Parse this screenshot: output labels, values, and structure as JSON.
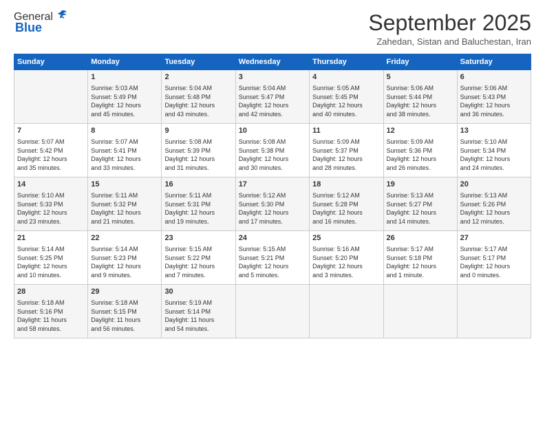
{
  "logo": {
    "general": "General",
    "blue": "Blue"
  },
  "title": "September 2025",
  "subtitle": "Zahedan, Sistan and Baluchestan, Iran",
  "days_header": [
    "Sunday",
    "Monday",
    "Tuesday",
    "Wednesday",
    "Thursday",
    "Friday",
    "Saturday"
  ],
  "weeks": [
    [
      {
        "day": "",
        "info": ""
      },
      {
        "day": "1",
        "info": "Sunrise: 5:03 AM\nSunset: 5:49 PM\nDaylight: 12 hours\nand 45 minutes."
      },
      {
        "day": "2",
        "info": "Sunrise: 5:04 AM\nSunset: 5:48 PM\nDaylight: 12 hours\nand 43 minutes."
      },
      {
        "day": "3",
        "info": "Sunrise: 5:04 AM\nSunset: 5:47 PM\nDaylight: 12 hours\nand 42 minutes."
      },
      {
        "day": "4",
        "info": "Sunrise: 5:05 AM\nSunset: 5:45 PM\nDaylight: 12 hours\nand 40 minutes."
      },
      {
        "day": "5",
        "info": "Sunrise: 5:06 AM\nSunset: 5:44 PM\nDaylight: 12 hours\nand 38 minutes."
      },
      {
        "day": "6",
        "info": "Sunrise: 5:06 AM\nSunset: 5:43 PM\nDaylight: 12 hours\nand 36 minutes."
      }
    ],
    [
      {
        "day": "7",
        "info": "Sunrise: 5:07 AM\nSunset: 5:42 PM\nDaylight: 12 hours\nand 35 minutes."
      },
      {
        "day": "8",
        "info": "Sunrise: 5:07 AM\nSunset: 5:41 PM\nDaylight: 12 hours\nand 33 minutes."
      },
      {
        "day": "9",
        "info": "Sunrise: 5:08 AM\nSunset: 5:39 PM\nDaylight: 12 hours\nand 31 minutes."
      },
      {
        "day": "10",
        "info": "Sunrise: 5:08 AM\nSunset: 5:38 PM\nDaylight: 12 hours\nand 30 minutes."
      },
      {
        "day": "11",
        "info": "Sunrise: 5:09 AM\nSunset: 5:37 PM\nDaylight: 12 hours\nand 28 minutes."
      },
      {
        "day": "12",
        "info": "Sunrise: 5:09 AM\nSunset: 5:36 PM\nDaylight: 12 hours\nand 26 minutes."
      },
      {
        "day": "13",
        "info": "Sunrise: 5:10 AM\nSunset: 5:34 PM\nDaylight: 12 hours\nand 24 minutes."
      }
    ],
    [
      {
        "day": "14",
        "info": "Sunrise: 5:10 AM\nSunset: 5:33 PM\nDaylight: 12 hours\nand 23 minutes."
      },
      {
        "day": "15",
        "info": "Sunrise: 5:11 AM\nSunset: 5:32 PM\nDaylight: 12 hours\nand 21 minutes."
      },
      {
        "day": "16",
        "info": "Sunrise: 5:11 AM\nSunset: 5:31 PM\nDaylight: 12 hours\nand 19 minutes."
      },
      {
        "day": "17",
        "info": "Sunrise: 5:12 AM\nSunset: 5:30 PM\nDaylight: 12 hours\nand 17 minutes."
      },
      {
        "day": "18",
        "info": "Sunrise: 5:12 AM\nSunset: 5:28 PM\nDaylight: 12 hours\nand 16 minutes."
      },
      {
        "day": "19",
        "info": "Sunrise: 5:13 AM\nSunset: 5:27 PM\nDaylight: 12 hours\nand 14 minutes."
      },
      {
        "day": "20",
        "info": "Sunrise: 5:13 AM\nSunset: 5:26 PM\nDaylight: 12 hours\nand 12 minutes."
      }
    ],
    [
      {
        "day": "21",
        "info": "Sunrise: 5:14 AM\nSunset: 5:25 PM\nDaylight: 12 hours\nand 10 minutes."
      },
      {
        "day": "22",
        "info": "Sunrise: 5:14 AM\nSunset: 5:23 PM\nDaylight: 12 hours\nand 9 minutes."
      },
      {
        "day": "23",
        "info": "Sunrise: 5:15 AM\nSunset: 5:22 PM\nDaylight: 12 hours\nand 7 minutes."
      },
      {
        "day": "24",
        "info": "Sunrise: 5:15 AM\nSunset: 5:21 PM\nDaylight: 12 hours\nand 5 minutes."
      },
      {
        "day": "25",
        "info": "Sunrise: 5:16 AM\nSunset: 5:20 PM\nDaylight: 12 hours\nand 3 minutes."
      },
      {
        "day": "26",
        "info": "Sunrise: 5:17 AM\nSunset: 5:18 PM\nDaylight: 12 hours\nand 1 minute."
      },
      {
        "day": "27",
        "info": "Sunrise: 5:17 AM\nSunset: 5:17 PM\nDaylight: 12 hours\nand 0 minutes."
      }
    ],
    [
      {
        "day": "28",
        "info": "Sunrise: 5:18 AM\nSunset: 5:16 PM\nDaylight: 11 hours\nand 58 minutes."
      },
      {
        "day": "29",
        "info": "Sunrise: 5:18 AM\nSunset: 5:15 PM\nDaylight: 11 hours\nand 56 minutes."
      },
      {
        "day": "30",
        "info": "Sunrise: 5:19 AM\nSunset: 5:14 PM\nDaylight: 11 hours\nand 54 minutes."
      },
      {
        "day": "",
        "info": ""
      },
      {
        "day": "",
        "info": ""
      },
      {
        "day": "",
        "info": ""
      },
      {
        "day": "",
        "info": ""
      }
    ]
  ]
}
